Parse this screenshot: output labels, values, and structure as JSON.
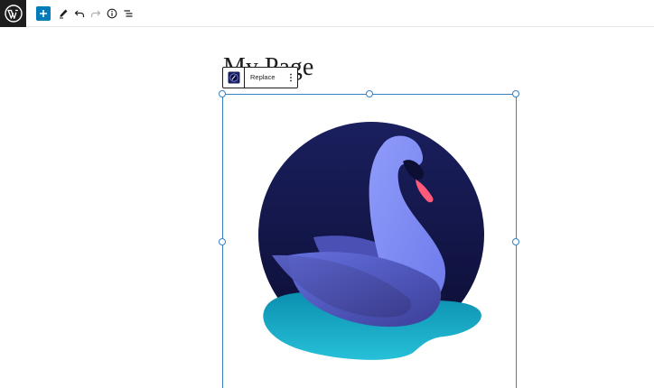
{
  "toolbar": {
    "logo_icon": "wordpress-logo-icon",
    "add_icon": "plus-icon",
    "tools_icon": "pen-icon",
    "undo_icon": "undo-icon",
    "redo_icon": "redo-icon",
    "details_icon": "info-icon",
    "list_view_icon": "list-view-icon"
  },
  "editor": {
    "post_title": "My Page"
  },
  "block_toolbar": {
    "block_type_icon": "image-block-icon",
    "replace_label": "Replace",
    "more_icon": "more-vertical-icon"
  },
  "image": {
    "subject": "swan-illustration",
    "colors": {
      "circle_top": "#1a1f5e",
      "circle_bottom": "#0c0e33",
      "swan_light": "#7b8bf5",
      "swan_dark": "#4348a8",
      "beak": "#ff5a7a",
      "water_light": "#27c0d8",
      "water_dark": "#0b8fb0"
    }
  },
  "selection_color": "#3582c4",
  "accent_color": "#007cba"
}
